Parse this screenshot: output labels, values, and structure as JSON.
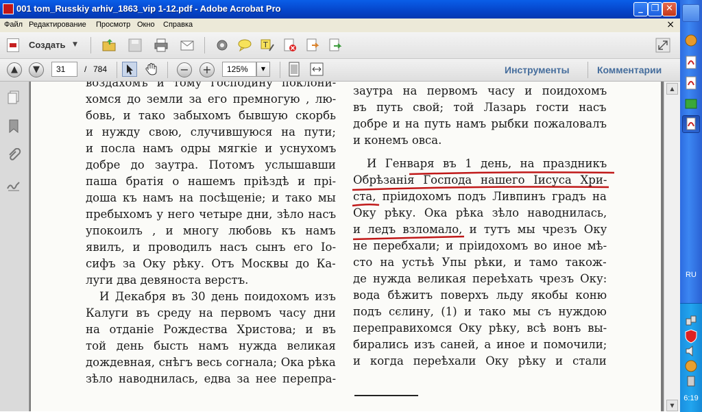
{
  "window": {
    "title": "001 tom_Russkiy arhiv_1863_vip 1-12.pdf - Adobe Acrobat Pro",
    "minimize": "_",
    "restore": "❐",
    "close": "✕"
  },
  "menu": {
    "items": [
      "Файл",
      "Редактирование",
      "Просмотр",
      "Окно",
      "Справка"
    ],
    "close": "×"
  },
  "toolbar": {
    "create_label": "Создать",
    "create_arrow": "▼"
  },
  "nav": {
    "page_current": "31",
    "page_sep": "/",
    "page_total": "784",
    "zoom": "125%",
    "zoom_arrow": "▼",
    "tools_label": "Инструменты",
    "comments_label": "Комментарии"
  },
  "document": {
    "left_column": [
      "воздахомъ и тому господину поклони-",
      "хомся до земли за его премногую , лю-",
      "бовь, и тако забыхомъ бывшую скорбь",
      "и нужду свою, случившуюся на пути;",
      "и посла намъ одры мягкіе и уснухомъ",
      "добре до заутра. Потомъ услышавши",
      "паша братія о нашемъ пріѣздѣ и прі-",
      "доша къ намъ на посѣщеніе; и тако мы",
      "пребыхомъ у него четыре дни, зѣло насъ",
      "упокоилъ , и многу любовь къ намъ",
      "явилъ, и проводилъ насъ сынъ его Іо-",
      "сифъ за Оку рѣку. Отъ Москвы до Ка-",
      "луги два девяноста верстъ.",
      "И Декабря въ 30 день поидохомъ изъ",
      "Калуги въ среду на первомъ часу дни",
      "на отданіе Рождества Христова; и въ",
      "той день бысть намъ нужда великая",
      "дождевная, снѣгъ весь согнала; Ока рѣка",
      "зѣло наводнилась, едва за нее перепра-"
    ],
    "right_column": [
      "заутра на первомъ часу и поидохомъ",
      "въ путь свой; той Лазарь гости насъ",
      "добре и на путь намъ рыбки пожаловалъ",
      "и конемъ овса.",
      "И Генваря въ 1 день, на праздникъ",
      "Обрѣзанія Господа нашего Іисуса Хри-",
      "ста, пріидохомъ подъ Ливпинъ градъ на",
      "Оку рѣку. Ока рѣка зѣло наводнилась,",
      "и ледъ взломало, и тутъ мы чрезъ Оку",
      "не перебхали; и пріидохомъ во иное мѣ-",
      "сто на устьѣ Упы рѣки, и тамо також-",
      "де нужда великая переѣхать чрезъ Оку:",
      "вода бѣжитъ поверхъ льду якобы коню",
      "подъ сєлину, (1) и тако мы съ нуждою",
      "переправихомся Оку рѣку, всѣ вонъ вы-",
      "бирались изъ саней, а иное и помочили;",
      "и когда переѣхали Оку рѣку и стали"
    ]
  },
  "taskbar": {
    "lang": "RU",
    "time": "6:19"
  },
  "colors": {
    "title_bar": "#0544c9",
    "accent_link": "#456d9c",
    "underline": "#c01818",
    "taskbar": "#3c86f2"
  }
}
